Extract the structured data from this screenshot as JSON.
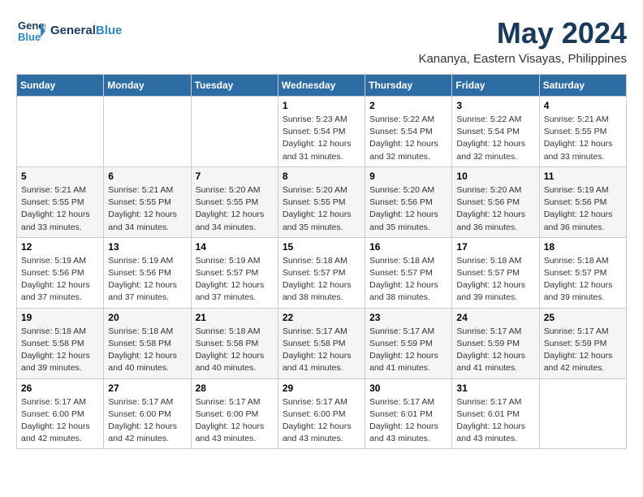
{
  "header": {
    "logo_line1": "General",
    "logo_line2": "Blue",
    "month_title": "May 2024",
    "location": "Kananya, Eastern Visayas, Philippines"
  },
  "weekdays": [
    "Sunday",
    "Monday",
    "Tuesday",
    "Wednesday",
    "Thursday",
    "Friday",
    "Saturday"
  ],
  "weeks": [
    [
      {
        "day": "",
        "sunrise": "",
        "sunset": "",
        "daylight": ""
      },
      {
        "day": "",
        "sunrise": "",
        "sunset": "",
        "daylight": ""
      },
      {
        "day": "",
        "sunrise": "",
        "sunset": "",
        "daylight": ""
      },
      {
        "day": "1",
        "sunrise": "Sunrise: 5:23 AM",
        "sunset": "Sunset: 5:54 PM",
        "daylight": "Daylight: 12 hours and 31 minutes."
      },
      {
        "day": "2",
        "sunrise": "Sunrise: 5:22 AM",
        "sunset": "Sunset: 5:54 PM",
        "daylight": "Daylight: 12 hours and 32 minutes."
      },
      {
        "day": "3",
        "sunrise": "Sunrise: 5:22 AM",
        "sunset": "Sunset: 5:54 PM",
        "daylight": "Daylight: 12 hours and 32 minutes."
      },
      {
        "day": "4",
        "sunrise": "Sunrise: 5:21 AM",
        "sunset": "Sunset: 5:55 PM",
        "daylight": "Daylight: 12 hours and 33 minutes."
      }
    ],
    [
      {
        "day": "5",
        "sunrise": "Sunrise: 5:21 AM",
        "sunset": "Sunset: 5:55 PM",
        "daylight": "Daylight: 12 hours and 33 minutes."
      },
      {
        "day": "6",
        "sunrise": "Sunrise: 5:21 AM",
        "sunset": "Sunset: 5:55 PM",
        "daylight": "Daylight: 12 hours and 34 minutes."
      },
      {
        "day": "7",
        "sunrise": "Sunrise: 5:20 AM",
        "sunset": "Sunset: 5:55 PM",
        "daylight": "Daylight: 12 hours and 34 minutes."
      },
      {
        "day": "8",
        "sunrise": "Sunrise: 5:20 AM",
        "sunset": "Sunset: 5:55 PM",
        "daylight": "Daylight: 12 hours and 35 minutes."
      },
      {
        "day": "9",
        "sunrise": "Sunrise: 5:20 AM",
        "sunset": "Sunset: 5:56 PM",
        "daylight": "Daylight: 12 hours and 35 minutes."
      },
      {
        "day": "10",
        "sunrise": "Sunrise: 5:20 AM",
        "sunset": "Sunset: 5:56 PM",
        "daylight": "Daylight: 12 hours and 36 minutes."
      },
      {
        "day": "11",
        "sunrise": "Sunrise: 5:19 AM",
        "sunset": "Sunset: 5:56 PM",
        "daylight": "Daylight: 12 hours and 36 minutes."
      }
    ],
    [
      {
        "day": "12",
        "sunrise": "Sunrise: 5:19 AM",
        "sunset": "Sunset: 5:56 PM",
        "daylight": "Daylight: 12 hours and 37 minutes."
      },
      {
        "day": "13",
        "sunrise": "Sunrise: 5:19 AM",
        "sunset": "Sunset: 5:56 PM",
        "daylight": "Daylight: 12 hours and 37 minutes."
      },
      {
        "day": "14",
        "sunrise": "Sunrise: 5:19 AM",
        "sunset": "Sunset: 5:57 PM",
        "daylight": "Daylight: 12 hours and 37 minutes."
      },
      {
        "day": "15",
        "sunrise": "Sunrise: 5:18 AM",
        "sunset": "Sunset: 5:57 PM",
        "daylight": "Daylight: 12 hours and 38 minutes."
      },
      {
        "day": "16",
        "sunrise": "Sunrise: 5:18 AM",
        "sunset": "Sunset: 5:57 PM",
        "daylight": "Daylight: 12 hours and 38 minutes."
      },
      {
        "day": "17",
        "sunrise": "Sunrise: 5:18 AM",
        "sunset": "Sunset: 5:57 PM",
        "daylight": "Daylight: 12 hours and 39 minutes."
      },
      {
        "day": "18",
        "sunrise": "Sunrise: 5:18 AM",
        "sunset": "Sunset: 5:57 PM",
        "daylight": "Daylight: 12 hours and 39 minutes."
      }
    ],
    [
      {
        "day": "19",
        "sunrise": "Sunrise: 5:18 AM",
        "sunset": "Sunset: 5:58 PM",
        "daylight": "Daylight: 12 hours and 39 minutes."
      },
      {
        "day": "20",
        "sunrise": "Sunrise: 5:18 AM",
        "sunset": "Sunset: 5:58 PM",
        "daylight": "Daylight: 12 hours and 40 minutes."
      },
      {
        "day": "21",
        "sunrise": "Sunrise: 5:18 AM",
        "sunset": "Sunset: 5:58 PM",
        "daylight": "Daylight: 12 hours and 40 minutes."
      },
      {
        "day": "22",
        "sunrise": "Sunrise: 5:17 AM",
        "sunset": "Sunset: 5:58 PM",
        "daylight": "Daylight: 12 hours and 41 minutes."
      },
      {
        "day": "23",
        "sunrise": "Sunrise: 5:17 AM",
        "sunset": "Sunset: 5:59 PM",
        "daylight": "Daylight: 12 hours and 41 minutes."
      },
      {
        "day": "24",
        "sunrise": "Sunrise: 5:17 AM",
        "sunset": "Sunset: 5:59 PM",
        "daylight": "Daylight: 12 hours and 41 minutes."
      },
      {
        "day": "25",
        "sunrise": "Sunrise: 5:17 AM",
        "sunset": "Sunset: 5:59 PM",
        "daylight": "Daylight: 12 hours and 42 minutes."
      }
    ],
    [
      {
        "day": "26",
        "sunrise": "Sunrise: 5:17 AM",
        "sunset": "Sunset: 6:00 PM",
        "daylight": "Daylight: 12 hours and 42 minutes."
      },
      {
        "day": "27",
        "sunrise": "Sunrise: 5:17 AM",
        "sunset": "Sunset: 6:00 PM",
        "daylight": "Daylight: 12 hours and 42 minutes."
      },
      {
        "day": "28",
        "sunrise": "Sunrise: 5:17 AM",
        "sunset": "Sunset: 6:00 PM",
        "daylight": "Daylight: 12 hours and 43 minutes."
      },
      {
        "day": "29",
        "sunrise": "Sunrise: 5:17 AM",
        "sunset": "Sunset: 6:00 PM",
        "daylight": "Daylight: 12 hours and 43 minutes."
      },
      {
        "day": "30",
        "sunrise": "Sunrise: 5:17 AM",
        "sunset": "Sunset: 6:01 PM",
        "daylight": "Daylight: 12 hours and 43 minutes."
      },
      {
        "day": "31",
        "sunrise": "Sunrise: 5:17 AM",
        "sunset": "Sunset: 6:01 PM",
        "daylight": "Daylight: 12 hours and 43 minutes."
      },
      {
        "day": "",
        "sunrise": "",
        "sunset": "",
        "daylight": ""
      }
    ]
  ]
}
